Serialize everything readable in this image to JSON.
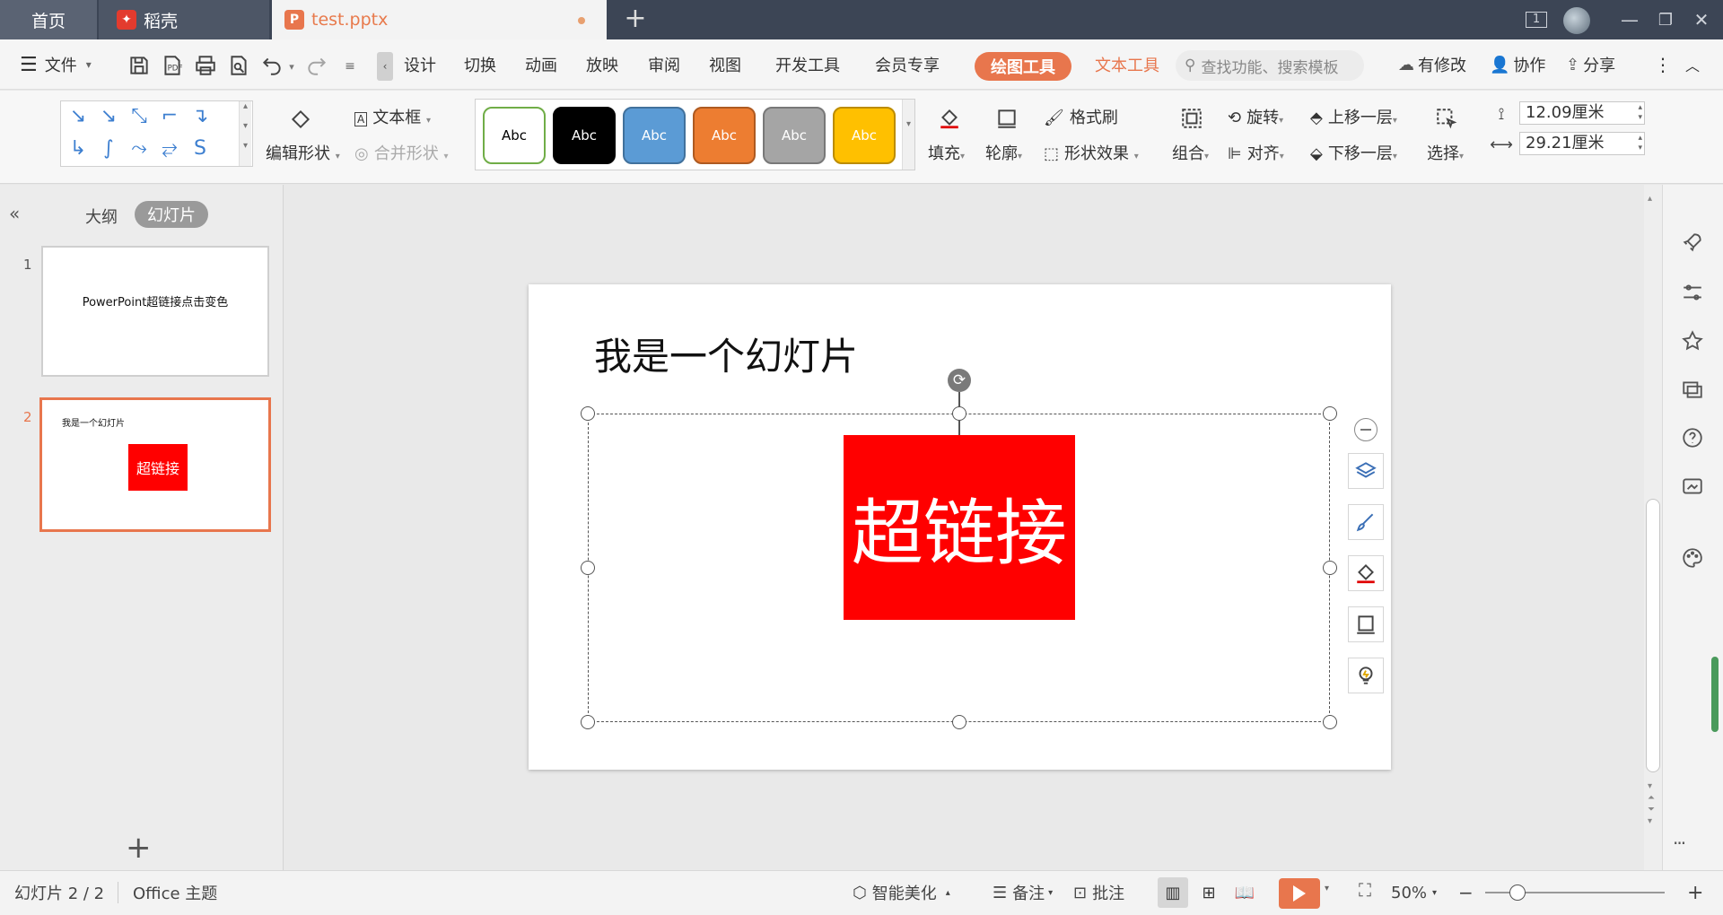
{
  "tabs": {
    "home": "首页",
    "daoke": "稻壳",
    "file": "test.pptx",
    "new_tab": "+"
  },
  "window": {
    "page_indicator": "1"
  },
  "menu": {
    "file": "文件",
    "items": [
      "设计",
      "切换",
      "动画",
      "放映",
      "审阅",
      "视图",
      "开发工具",
      "会员专享"
    ],
    "drawing_tools": "绘图工具",
    "text_tools": "文本工具",
    "search_placeholder": "查找功能、搜索模板",
    "has_changes": "有修改",
    "collaborate": "协作",
    "share": "分享"
  },
  "ribbon": {
    "edit_shape": "编辑形状",
    "text_box": "文本框",
    "merge_shape": "合并形状",
    "styles": [
      {
        "label": "Abc",
        "bg": "#ffffff",
        "border": "#70ad47",
        "color": "#000000"
      },
      {
        "label": "Abc",
        "bg": "#000000",
        "border": "#000000",
        "color": "#ffffff"
      },
      {
        "label": "Abc",
        "bg": "#5b9bd5",
        "border": "#41719c",
        "color": "#ffffff"
      },
      {
        "label": "Abc",
        "bg": "#ed7d31",
        "border": "#ae5a21",
        "color": "#ffffff"
      },
      {
        "label": "Abc",
        "bg": "#a5a5a5",
        "border": "#787878",
        "color": "#ffffff"
      },
      {
        "label": "Abc",
        "bg": "#ffc000",
        "border": "#bc8c00",
        "color": "#ffffff"
      }
    ],
    "fill": "填充",
    "outline": "轮廓",
    "format_painter": "格式刷",
    "shape_effects": "形状效果",
    "group": "组合",
    "rotate": "旋转",
    "align": "对齐",
    "bring_forward": "上移一层",
    "send_backward": "下移一层",
    "select": "选择",
    "height": "12.09厘米",
    "width": "29.21厘米"
  },
  "panel": {
    "outline_tab": "大纲",
    "slides_tab": "幻灯片",
    "thumbs": [
      {
        "num": "1",
        "text": "PowerPoint超链接点击变色"
      },
      {
        "num": "2",
        "title": "我是一个幻灯片",
        "box": "超链接"
      }
    ],
    "add": "+"
  },
  "slide": {
    "title": "我是一个幻灯片",
    "hyperlink_box": "超链接",
    "hyperlink_color": "#ff0000"
  },
  "status": {
    "slide_counter": "幻灯片 2 / 2",
    "theme": "Office 主题",
    "smart_beautify": "智能美化",
    "notes": "备注",
    "comments": "批注",
    "zoom": "50%",
    "zoom_level": 0.5,
    "minus": "−",
    "plus": "+"
  },
  "sidebar": {
    "more": "···"
  },
  "colors": {
    "accent": "#e8764d",
    "tab_bar": "#3c4555"
  }
}
